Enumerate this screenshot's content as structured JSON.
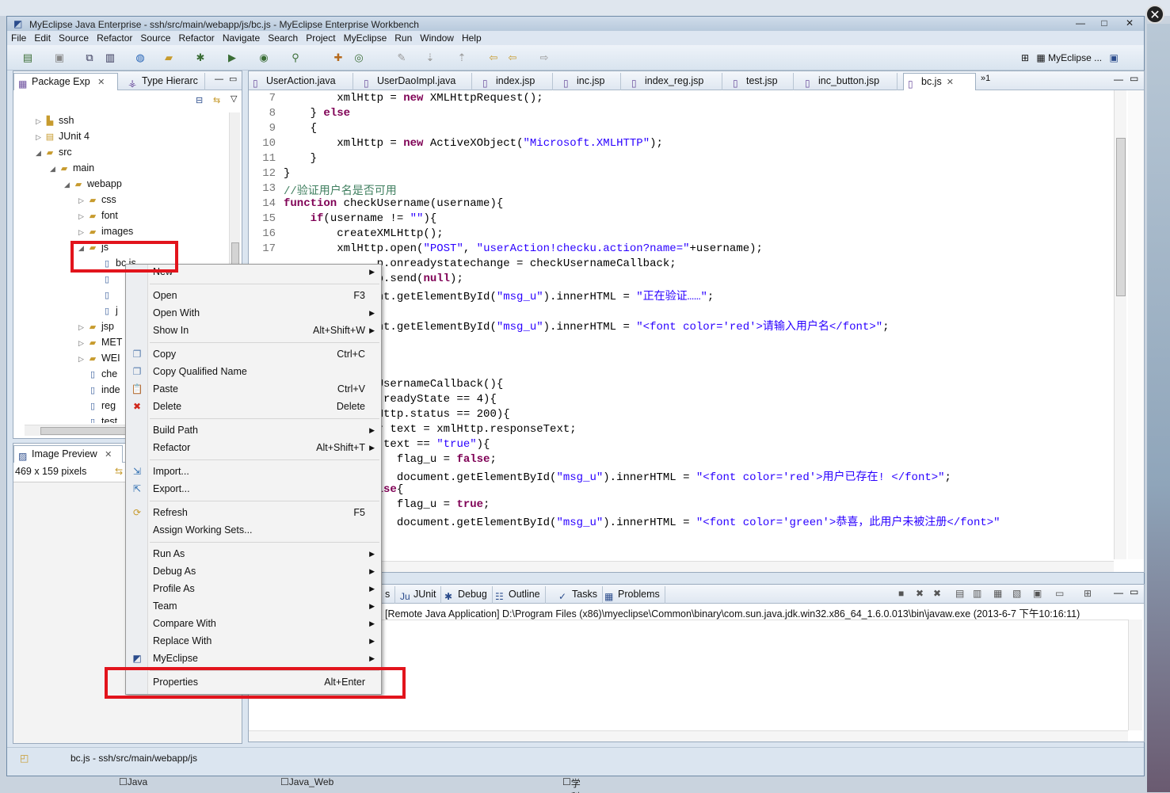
{
  "window": {
    "title": "MyEclipse Java Enterprise - ssh/src/main/webapp/js/bc.js - MyEclipse Enterprise Workbench"
  },
  "menubar": [
    "File",
    "Edit",
    "Source",
    "Refactor",
    "Source",
    "Refactor",
    "Navigate",
    "Search",
    "Project",
    "MyEclipse",
    "Run",
    "Window",
    "Help"
  ],
  "perspective": "MyEclipse ...",
  "left_panel": {
    "tabs": [
      {
        "label": "Package Exp"
      },
      {
        "label": "Type Hierarc"
      }
    ],
    "tree": [
      {
        "label": "ssh",
        "icon": "project-icon",
        "arrow": "▷",
        "indent": 0
      },
      {
        "label": "JUnit 4",
        "icon": "library-icon",
        "arrow": "▷",
        "indent": 0
      },
      {
        "label": "src",
        "icon": "folder-icon",
        "arrow": "◢",
        "indent": 0
      },
      {
        "label": "main",
        "icon": "folder-icon",
        "arrow": "◢",
        "indent": 1
      },
      {
        "label": "webapp",
        "icon": "folder-icon",
        "arrow": "◢",
        "indent": 2
      },
      {
        "label": "css",
        "icon": "folder-icon",
        "arrow": "▷",
        "indent": 3
      },
      {
        "label": "font",
        "icon": "folder-icon",
        "arrow": "▷",
        "indent": 3
      },
      {
        "label": "images",
        "icon": "folder-icon",
        "arrow": "▷",
        "indent": 3
      },
      {
        "label": "js",
        "icon": "folder-icon",
        "arrow": "◢",
        "indent": 3
      },
      {
        "label": "bc.js",
        "icon": "js-file-icon",
        "arrow": "",
        "indent": 4
      },
      {
        "label": "",
        "icon": "js-file-icon",
        "arrow": "",
        "indent": 4
      },
      {
        "label": "",
        "icon": "js-file-icon",
        "arrow": "",
        "indent": 4
      },
      {
        "label": "j",
        "icon": "js-file-icon",
        "arrow": "",
        "indent": 4
      },
      {
        "label": "jsp",
        "icon": "folder-icon",
        "arrow": "▷",
        "indent": 3
      },
      {
        "label": "MET",
        "icon": "folder-icon",
        "arrow": "▷",
        "indent": 3
      },
      {
        "label": "WEI",
        "icon": "folder-icon",
        "arrow": "▷",
        "indent": 3
      },
      {
        "label": "che",
        "icon": "jsp-file-icon",
        "arrow": "",
        "indent": 3
      },
      {
        "label": "inde",
        "icon": "jsp-file-icon",
        "arrow": "",
        "indent": 3
      },
      {
        "label": "reg",
        "icon": "jsp-file-icon",
        "arrow": "",
        "indent": 3
      },
      {
        "label": "test",
        "icon": "jsp-file-icon",
        "arrow": "",
        "indent": 3
      }
    ]
  },
  "image_preview": {
    "tab": "Image Preview",
    "size": "469 x 159 pixels"
  },
  "editor": {
    "tabs": [
      "UserAction.java",
      "UserDaoImpl.java",
      "index.jsp",
      "inc.jsp",
      "index_reg.jsp",
      "test.jsp",
      "inc_button.jsp",
      "bc.js"
    ],
    "overflow": "»1",
    "lines": [
      {
        "n": "7",
        "html": "        xmlHttp = <span class=\"kw\">new</span> XMLHttpRequest();"
      },
      {
        "n": "8",
        "html": "    } <span class=\"kw\">else</span>"
      },
      {
        "n": "9",
        "html": "    {"
      },
      {
        "n": "10",
        "html": "        xmlHttp = <span class=\"kw\">new</span> ActiveXObject(<span class=\"str\">\"Microsoft.XMLHTTP\"</span>);"
      },
      {
        "n": "11",
        "html": "    }"
      },
      {
        "n": "12",
        "html": "}"
      },
      {
        "n": "13",
        "html": "<span class=\"cm\">//验证用户名是否可用</span>"
      },
      {
        "n": "14",
        "html": "<span class=\"kw\">function</span> checkUsername(username){"
      },
      {
        "n": "15",
        "html": "    <span class=\"kw\">if</span>(username != <span class=\"str\">\"\"</span>){"
      },
      {
        "n": "16",
        "html": "        createXMLHttp();"
      },
      {
        "n": "17",
        "html": "        xmlHttp.open(<span class=\"str\">\"POST\"</span>, <span class=\"str\">\"userAction!checku.action?name=\"</span>+username);"
      },
      {
        "n": "",
        "html": "              p.onreadystatechange = checkUsernameCallback;"
      },
      {
        "n": "",
        "html": "              p.send(<span class=\"kw\">null</span>);"
      },
      {
        "n": "",
        "html": "              nt.getElementById(<span class=\"str\">\"msg_u\"</span>).innerHTML = <span class=\"str\">\"正在验证……\"</span>;"
      },
      {
        "n": "",
        "html": ""
      },
      {
        "n": "",
        "html": "              nt.getElementById(<span class=\"str\">\"msg_u\"</span>).innerHTML = <span class=\"str\">\"&lt;font color='red'&gt;请输入用户名&lt;/font&gt;\"</span>;"
      },
      {
        "n": "",
        "html": ""
      },
      {
        "n": "",
        "html": ""
      },
      {
        "n": "",
        "html": ""
      },
      {
        "n": "",
        "html": "              UsernameCallback(){"
      },
      {
        "n": "",
        "html": "              .readyState == 4){"
      },
      {
        "n": "",
        "html": "              Http.status == 200){"
      },
      {
        "n": "",
        "html": "              r text = xmlHttp.responseText;"
      },
      {
        "n": "",
        "html": "              (text == <span class=\"str\">\"true\"</span>){"
      },
      {
        "n": "",
        "html": "                 flag_u = <span class=\"kw\">false</span>;"
      },
      {
        "n": "",
        "html": "                 document.getElementById(<span class=\"str\">\"msg_u\"</span>).innerHTML = <span class=\"str\">\"&lt;font color='red'&gt;用户已存在! &lt;/font&gt;\"</span>;"
      },
      {
        "n": "",
        "html": "              <span class=\"kw\">lse</span>{"
      },
      {
        "n": "",
        "html": "                 flag_u = <span class=\"kw\">true</span>;"
      },
      {
        "n": "",
        "html": "                 document.getElementById(<span class=\"str\">\"msg_u\"</span>).innerHTML = <span class=\"str\">\"&lt;font color='green'&gt;恭喜，此用户未被注册&lt;/font&gt;\"</span>"
      }
    ]
  },
  "bottom_panel": {
    "tabs": [
      "s",
      "JUnit",
      "Debug",
      "Outline",
      "Tasks",
      "Problems"
    ],
    "console_line": "[Remote Java Application] D:\\Program Files (x86)\\myeclipse\\Common\\binary\\com.sun.java.jdk.win32.x86_64_1.6.0.013\\bin\\javaw.exe (2013-6-7 下午10:16:11)"
  },
  "context_menu": {
    "items": [
      {
        "label": "New",
        "shortcut": "",
        "submenu": true,
        "icon": ""
      },
      {
        "sep": true
      },
      {
        "label": "Open",
        "shortcut": "F3",
        "submenu": false,
        "icon": ""
      },
      {
        "label": "Open With",
        "shortcut": "",
        "submenu": true,
        "icon": ""
      },
      {
        "label": "Show In",
        "shortcut": "Alt+Shift+W",
        "submenu": true,
        "icon": ""
      },
      {
        "sep": true
      },
      {
        "label": "Copy",
        "shortcut": "Ctrl+C",
        "submenu": false,
        "icon": "copy-icon"
      },
      {
        "label": "Copy Qualified Name",
        "shortcut": "",
        "submenu": false,
        "icon": "copy-icon"
      },
      {
        "label": "Paste",
        "shortcut": "Ctrl+V",
        "submenu": false,
        "icon": "paste-icon"
      },
      {
        "label": "Delete",
        "shortcut": "Delete",
        "submenu": false,
        "icon": "delete-icon"
      },
      {
        "sep": true
      },
      {
        "label": "Build Path",
        "shortcut": "",
        "submenu": true,
        "icon": ""
      },
      {
        "label": "Refactor",
        "shortcut": "Alt+Shift+T",
        "submenu": true,
        "icon": ""
      },
      {
        "sep": true
      },
      {
        "label": "Import...",
        "shortcut": "",
        "submenu": false,
        "icon": "import-icon"
      },
      {
        "label": "Export...",
        "shortcut": "",
        "submenu": false,
        "icon": "export-icon"
      },
      {
        "sep": true
      },
      {
        "label": "Refresh",
        "shortcut": "F5",
        "submenu": false,
        "icon": "refresh-icon"
      },
      {
        "label": "Assign Working Sets...",
        "shortcut": "",
        "submenu": false,
        "icon": ""
      },
      {
        "sep": true
      },
      {
        "label": "Run As",
        "shortcut": "",
        "submenu": true,
        "icon": ""
      },
      {
        "label": "Debug As",
        "shortcut": "",
        "submenu": true,
        "icon": ""
      },
      {
        "label": "Profile As",
        "shortcut": "",
        "submenu": true,
        "icon": ""
      },
      {
        "label": "Team",
        "shortcut": "",
        "submenu": true,
        "icon": ""
      },
      {
        "label": "Compare With",
        "shortcut": "",
        "submenu": true,
        "icon": ""
      },
      {
        "label": "Replace With",
        "shortcut": "",
        "submenu": true,
        "icon": ""
      },
      {
        "label": "MyEclipse",
        "shortcut": "",
        "submenu": true,
        "icon": "myeclipse-icon"
      },
      {
        "sep": true
      },
      {
        "label": "Properties",
        "shortcut": "Alt+Enter",
        "submenu": false,
        "icon": ""
      }
    ]
  },
  "status": {
    "path": "bc.js - ssh/src/main/webapp/js"
  },
  "taskbar": [
    "Java",
    "Java_Web",
    "学科前沿"
  ],
  "colors": {
    "highlight": "#e2141c",
    "keyword": "#7f0055",
    "string": "#2a00ff",
    "comment": "#3f7f5f"
  }
}
